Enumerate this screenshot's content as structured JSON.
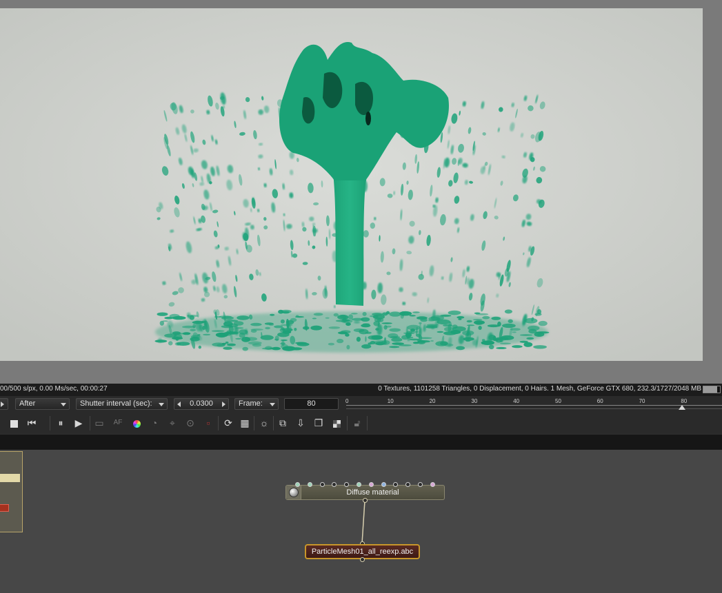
{
  "status": {
    "left": "00/500 s/px, 0.00 Ms/sec, 00:00:27",
    "right": "0 Textures, 1101258 Triangles, 0 Displacement, 0 Hairs. 1 Mesh, GeForce GTX 680, 232.3/1727/2048 MB",
    "gpu_memory_used_fraction": 0.84
  },
  "controls": {
    "mode_dropdown": "After",
    "shutter_label": "Shutter interval (sec):",
    "shutter_value": "0.0300",
    "frame_label": "Frame:",
    "frame_value": "80"
  },
  "timeline": {
    "ticks": [
      "0",
      "10",
      "20",
      "30",
      "40",
      "50",
      "60",
      "70",
      "80"
    ],
    "range": [
      0,
      90
    ],
    "current_frame": 80
  },
  "toolbar": {
    "icons": [
      "stop-icon",
      "rewind-to-start-icon",
      "pause-icon",
      "play-icon",
      "display-icon",
      "autofocus-icon",
      "color-picker-icon",
      "material-picker-icon",
      "camera-target-icon",
      "delete-object-icon",
      "refresh-render-icon",
      "region-render-icon",
      "gamma-icon",
      "copy-icon",
      "export-icon",
      "clone-icon",
      "checker-icon",
      "lock-icon"
    ]
  },
  "nodes": {
    "diffuse_material": {
      "label": "Diffuse material",
      "pin_colors": [
        "#9fd3b8",
        "#9fd3b8",
        "#2c2c2c",
        "#2c2c2c",
        "#2c2c2c",
        "#9fd3b8",
        "#d7a7d4",
        "#8fb3e0",
        "#2c2c2c",
        "#2c2c2c",
        "#2c2c2c",
        "#d7a7d4"
      ]
    },
    "mesh": {
      "label": "ParticleMesh01_all_reexp.abc"
    }
  },
  "colors": {
    "fluid": "#1fa57a",
    "background": "#d2d5d0",
    "node_highlight": "#c8962a"
  }
}
